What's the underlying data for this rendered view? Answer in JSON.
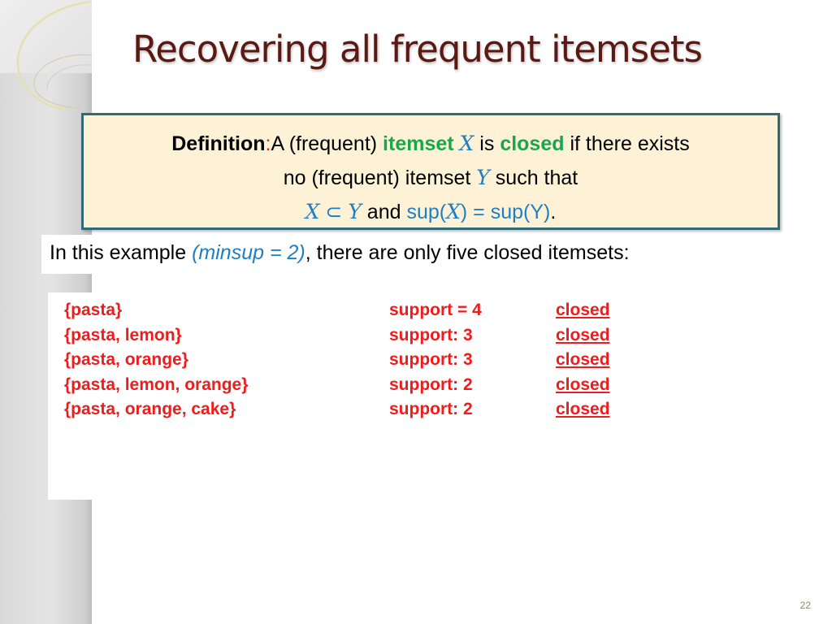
{
  "slide": {
    "title": "Recovering all frequent itemsets",
    "page_number": "22"
  },
  "definition": {
    "label": "Definition",
    "colon": ":",
    "line1_a": "A (frequent) ",
    "line1_itemset": "itemset",
    "line1_var_x": "X",
    "line1_is": " is ",
    "line1_closed": "closed",
    "line1_b": " if there exists",
    "line2_a": "no (frequent) itemset ",
    "line2_var_y": "Y",
    "line2_b": " such that",
    "line3_var_x": "X",
    "line3_subset": " ⊂ ",
    "line3_var_y": "Y",
    "line3_and": " and ",
    "line3_sup_open": "sup(",
    "line3_sup_x": "X",
    "line3_sup_mid": ") = sup(Y)",
    "line3_period": "."
  },
  "example": {
    "prefix": "In this example ",
    "minsup": "(minsup = 2)",
    "suffix": ", there are only five closed itemsets:"
  },
  "closed_itemsets": [
    {
      "itemset": "{pasta}",
      "support": "support = 4",
      "status": "closed"
    },
    {
      "itemset": "{pasta, lemon}",
      "support": "support: 3",
      "status": "closed"
    },
    {
      "itemset": "{pasta, orange}",
      "support": "support: 3",
      "status": "closed"
    },
    {
      "itemset": "{pasta, lemon, orange}",
      "support": "support: 2",
      "status": "closed"
    },
    {
      "itemset": "{pasta, orange, cake}",
      "support": "support: 2",
      "status": "closed"
    }
  ],
  "colors": {
    "title": "#5a1a13",
    "definition_bg": "#fdf2d6",
    "definition_border": "#2f6a78",
    "highlight_green": "#1aa64a",
    "math_blue": "#1f7fc4",
    "itemset_red": "#ee1c1c"
  }
}
